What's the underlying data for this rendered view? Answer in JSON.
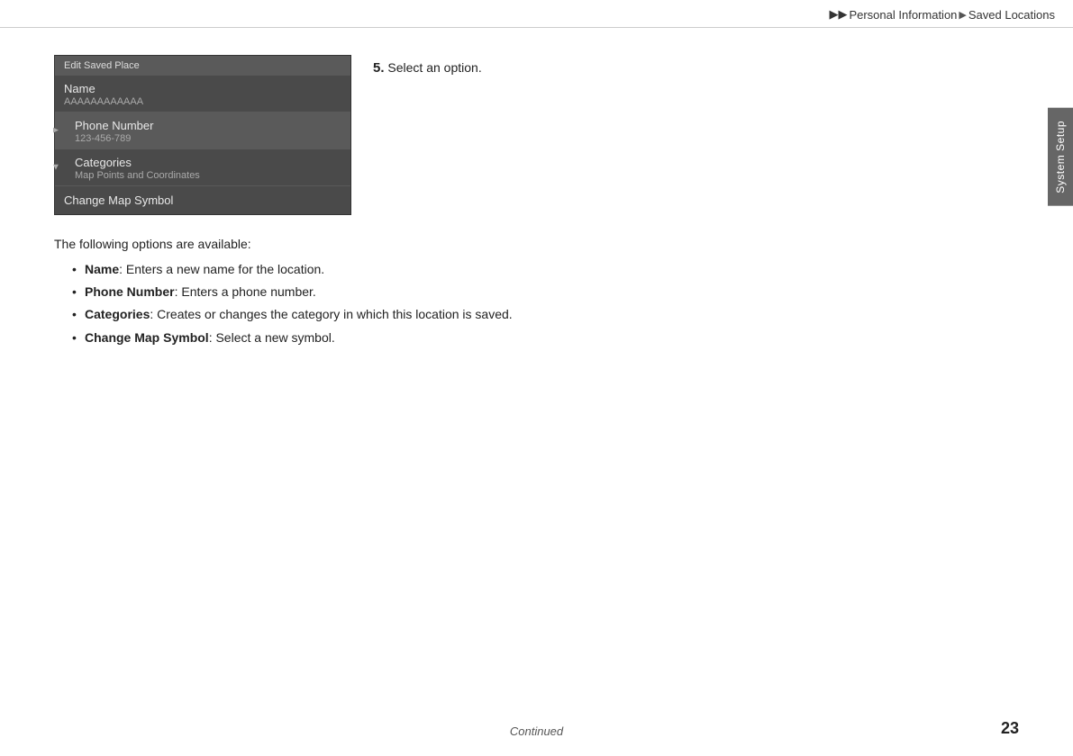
{
  "breadcrumb": {
    "arrow1": "▶▶",
    "section1": "Personal Information",
    "arrow2": "▶",
    "section2": "Saved Locations"
  },
  "side_tab": {
    "label": "System Setup"
  },
  "screen": {
    "title_bar": "Edit Saved Place",
    "items": [
      {
        "id": "name",
        "title": "Name",
        "subtitle": "AAAAAAAAAAAA",
        "selected": false,
        "left_icon": null
      },
      {
        "id": "phone-number",
        "title": "Phone Number",
        "subtitle": "123-456-789",
        "selected": true,
        "left_icon": "right-arrow"
      },
      {
        "id": "categories",
        "title": "Categories",
        "subtitle": "Map Points and Coordinates",
        "selected": false,
        "left_icon": "down-arrow"
      }
    ],
    "last_item": {
      "id": "change-map-symbol",
      "title": "Change Map Symbol"
    }
  },
  "step": {
    "number": "5.",
    "instruction": "Select an option."
  },
  "description": "The following options are available:",
  "bullet_list": [
    {
      "term": "Name",
      "text": ": Enters a new name for the location."
    },
    {
      "term": "Phone Number",
      "text": ": Enters a phone number."
    },
    {
      "term": "Categories",
      "text": ": Creates or changes the category in which this location is saved."
    },
    {
      "term": "Change Map Symbol",
      "text": ": Select a new symbol."
    }
  ],
  "footer": {
    "continued": "Continued",
    "page_number": "23"
  }
}
